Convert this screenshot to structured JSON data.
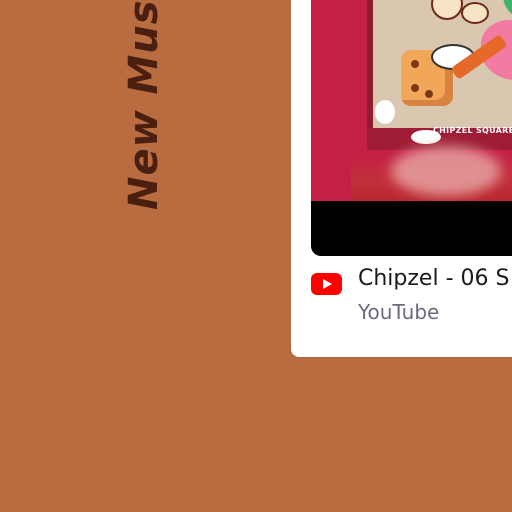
{
  "page": {
    "background_color": "#b86c40"
  },
  "heading": {
    "text": "New Mus",
    "color": "#4a1f10"
  },
  "embed_card": {
    "video": {
      "thumbnail_caption": "CHIPZEL SQUARE"
    },
    "title": "Chipzel - 06 S",
    "source": "YouTube",
    "source_icon": "youtube-icon",
    "brand_color": "#ff0000"
  }
}
